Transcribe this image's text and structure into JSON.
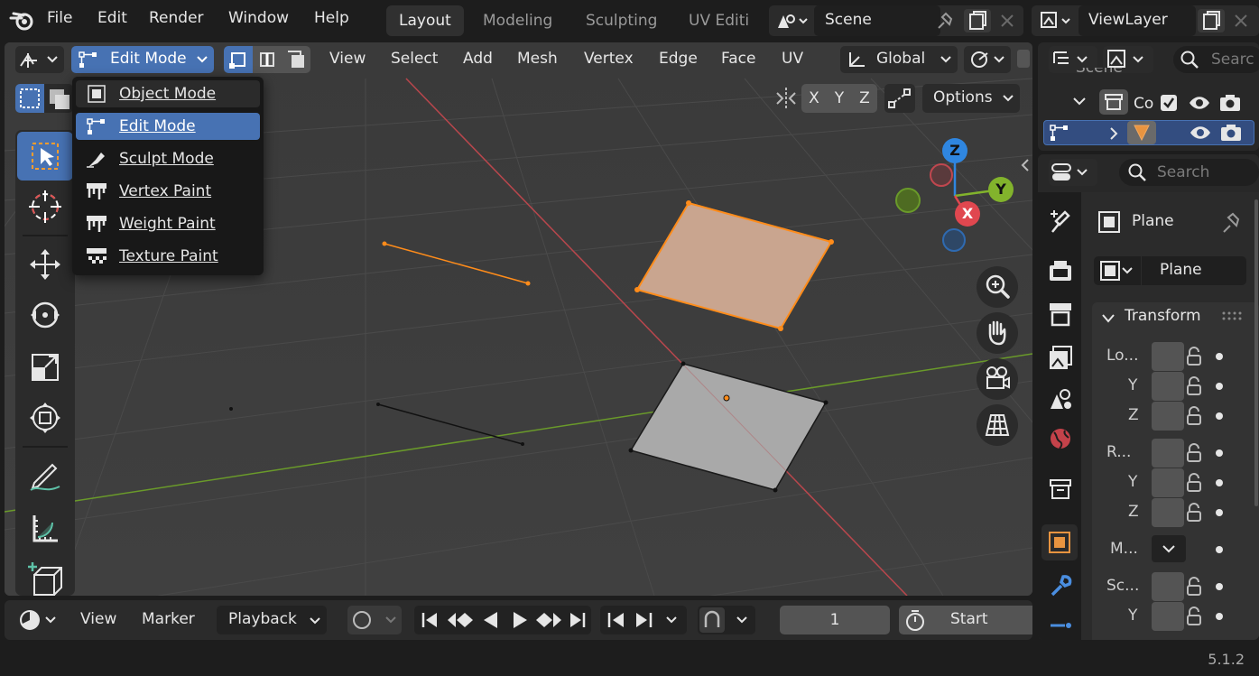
{
  "topbar": {
    "menus": [
      "File",
      "Edit",
      "Render",
      "Window",
      "Help"
    ],
    "workspaces": [
      "Layout",
      "Modeling",
      "Sculpting",
      "UV Editi"
    ],
    "active_workspace": "Layout",
    "scene_name": "Scene",
    "viewlayer_name": "ViewLayer"
  },
  "viewport_header": {
    "mode": "Edit Mode",
    "menus": [
      "View",
      "Select",
      "Add",
      "Mesh",
      "Vertex",
      "Edge",
      "Face",
      "UV"
    ],
    "orientation": "Global",
    "options": "Options",
    "axes": [
      "X",
      "Y",
      "Z"
    ]
  },
  "mode_menu": {
    "items": [
      {
        "label": "Object Mode",
        "icon": "object-mode-icon"
      },
      {
        "label": "Edit Mode",
        "icon": "edit-mode-icon",
        "selected": true
      },
      {
        "label": "Sculpt Mode",
        "icon": "sculpt-mode-icon"
      },
      {
        "label": "Vertex Paint",
        "icon": "vertex-paint-icon"
      },
      {
        "label": "Weight Paint",
        "icon": "weight-paint-icon"
      },
      {
        "label": "Texture Paint",
        "icon": "texture-paint-icon"
      }
    ]
  },
  "gizmo": {
    "x": "X",
    "y": "Y",
    "z": "Z"
  },
  "timeline": {
    "menus": [
      "View",
      "Marker"
    ],
    "playback": "Playback",
    "frame": "1",
    "start": "Start"
  },
  "outliner": {
    "row1": "Scene",
    "row2": "Co"
  },
  "properties": {
    "search_placeholder": "Search",
    "object_name": "Plane",
    "data_name": "Plane",
    "panel_title": "Transform",
    "rows": [
      "Lo...",
      "Y",
      "Z",
      "R...",
      "Y",
      "Z",
      "M...",
      "Sc...",
      "Y"
    ]
  },
  "outliner_search_placeholder": "Searc",
  "status": {
    "version": "5.1.2"
  },
  "colors": {
    "accent": "#4772b3",
    "selected_orange": "#ff8c1a",
    "x_axis": "#e0474f",
    "y_axis": "#82b32c",
    "z_axis": "#2f86e0"
  }
}
